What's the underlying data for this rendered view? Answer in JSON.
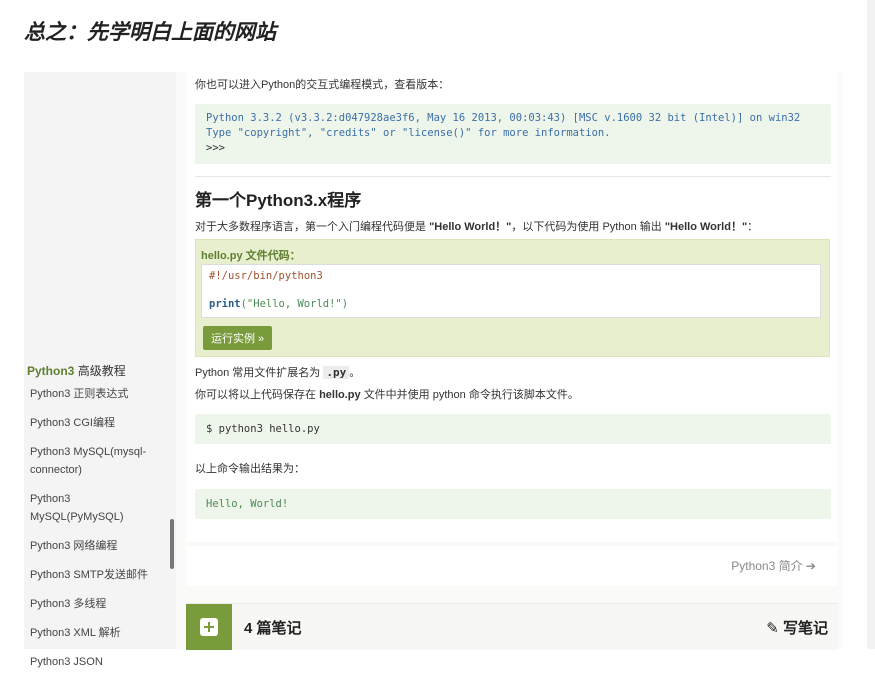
{
  "heading": "总之：先学明白上面的网站",
  "sidebar": {
    "category_label": "Python3",
    "category_sub": "高级教程",
    "items": [
      "Python3 正则表达式",
      "Python3 CGI编程",
      "Python3 MySQL(mysql-connector)",
      "Python3 MySQL(PyMySQL)",
      "Python3 网络编程",
      "Python3 SMTP发送邮件",
      "Python3 多线程",
      "Python3 XML 解析",
      "Python3 JSON"
    ]
  },
  "content": {
    "intro_text": "你也可以进入Python的交互式编程模式，查看版本：",
    "version_code": {
      "line1": "Python 3.3.2 (v3.3.2:d047928ae3f6, May 16 2013, 00:03:43) [MSC v.1600 32 bit (Intel)] on win32",
      "line2": "Type \"copyright\", \"credits\" or \"license()\" for more information.",
      "line3": ">>>"
    },
    "section_title": "第一个Python3.x程序",
    "section_desc_prefix": "对于大多数程序语言，第一个入门编程代码便是",
    "hello_world": "\"Hello World！\"",
    "section_desc_mid": "，以下代码为使用 Python 输出",
    "section_desc_suffix": "：",
    "example": {
      "title": "hello.py 文件代码：",
      "code_line1": "#!/usr/bin/python3",
      "code_print": "print",
      "code_args": "(\"Hello, World!\")",
      "run_button": "运行实例 »"
    },
    "ext_text_prefix": "Python 常用文件扩展名为",
    "ext_value": ".py",
    "ext_text_suffix": "。",
    "save_text_prefix": "你可以将以上代码保存在",
    "save_file": "hello.py",
    "save_text_suffix": "文件中并使用 python 命令执行该脚本文件。",
    "command": "$ python3 hello.py",
    "output_label": "以上命令输出结果为：",
    "output": "Hello, World!",
    "next_link": "Python3 简介 ➔"
  },
  "notes": {
    "count": "4 篇笔记",
    "write": "✎ 写笔记"
  },
  "colors": {
    "accent_green": "#7a9b3c",
    "code_bg": "#eef5ea",
    "example_bg": "#e8efcf"
  }
}
